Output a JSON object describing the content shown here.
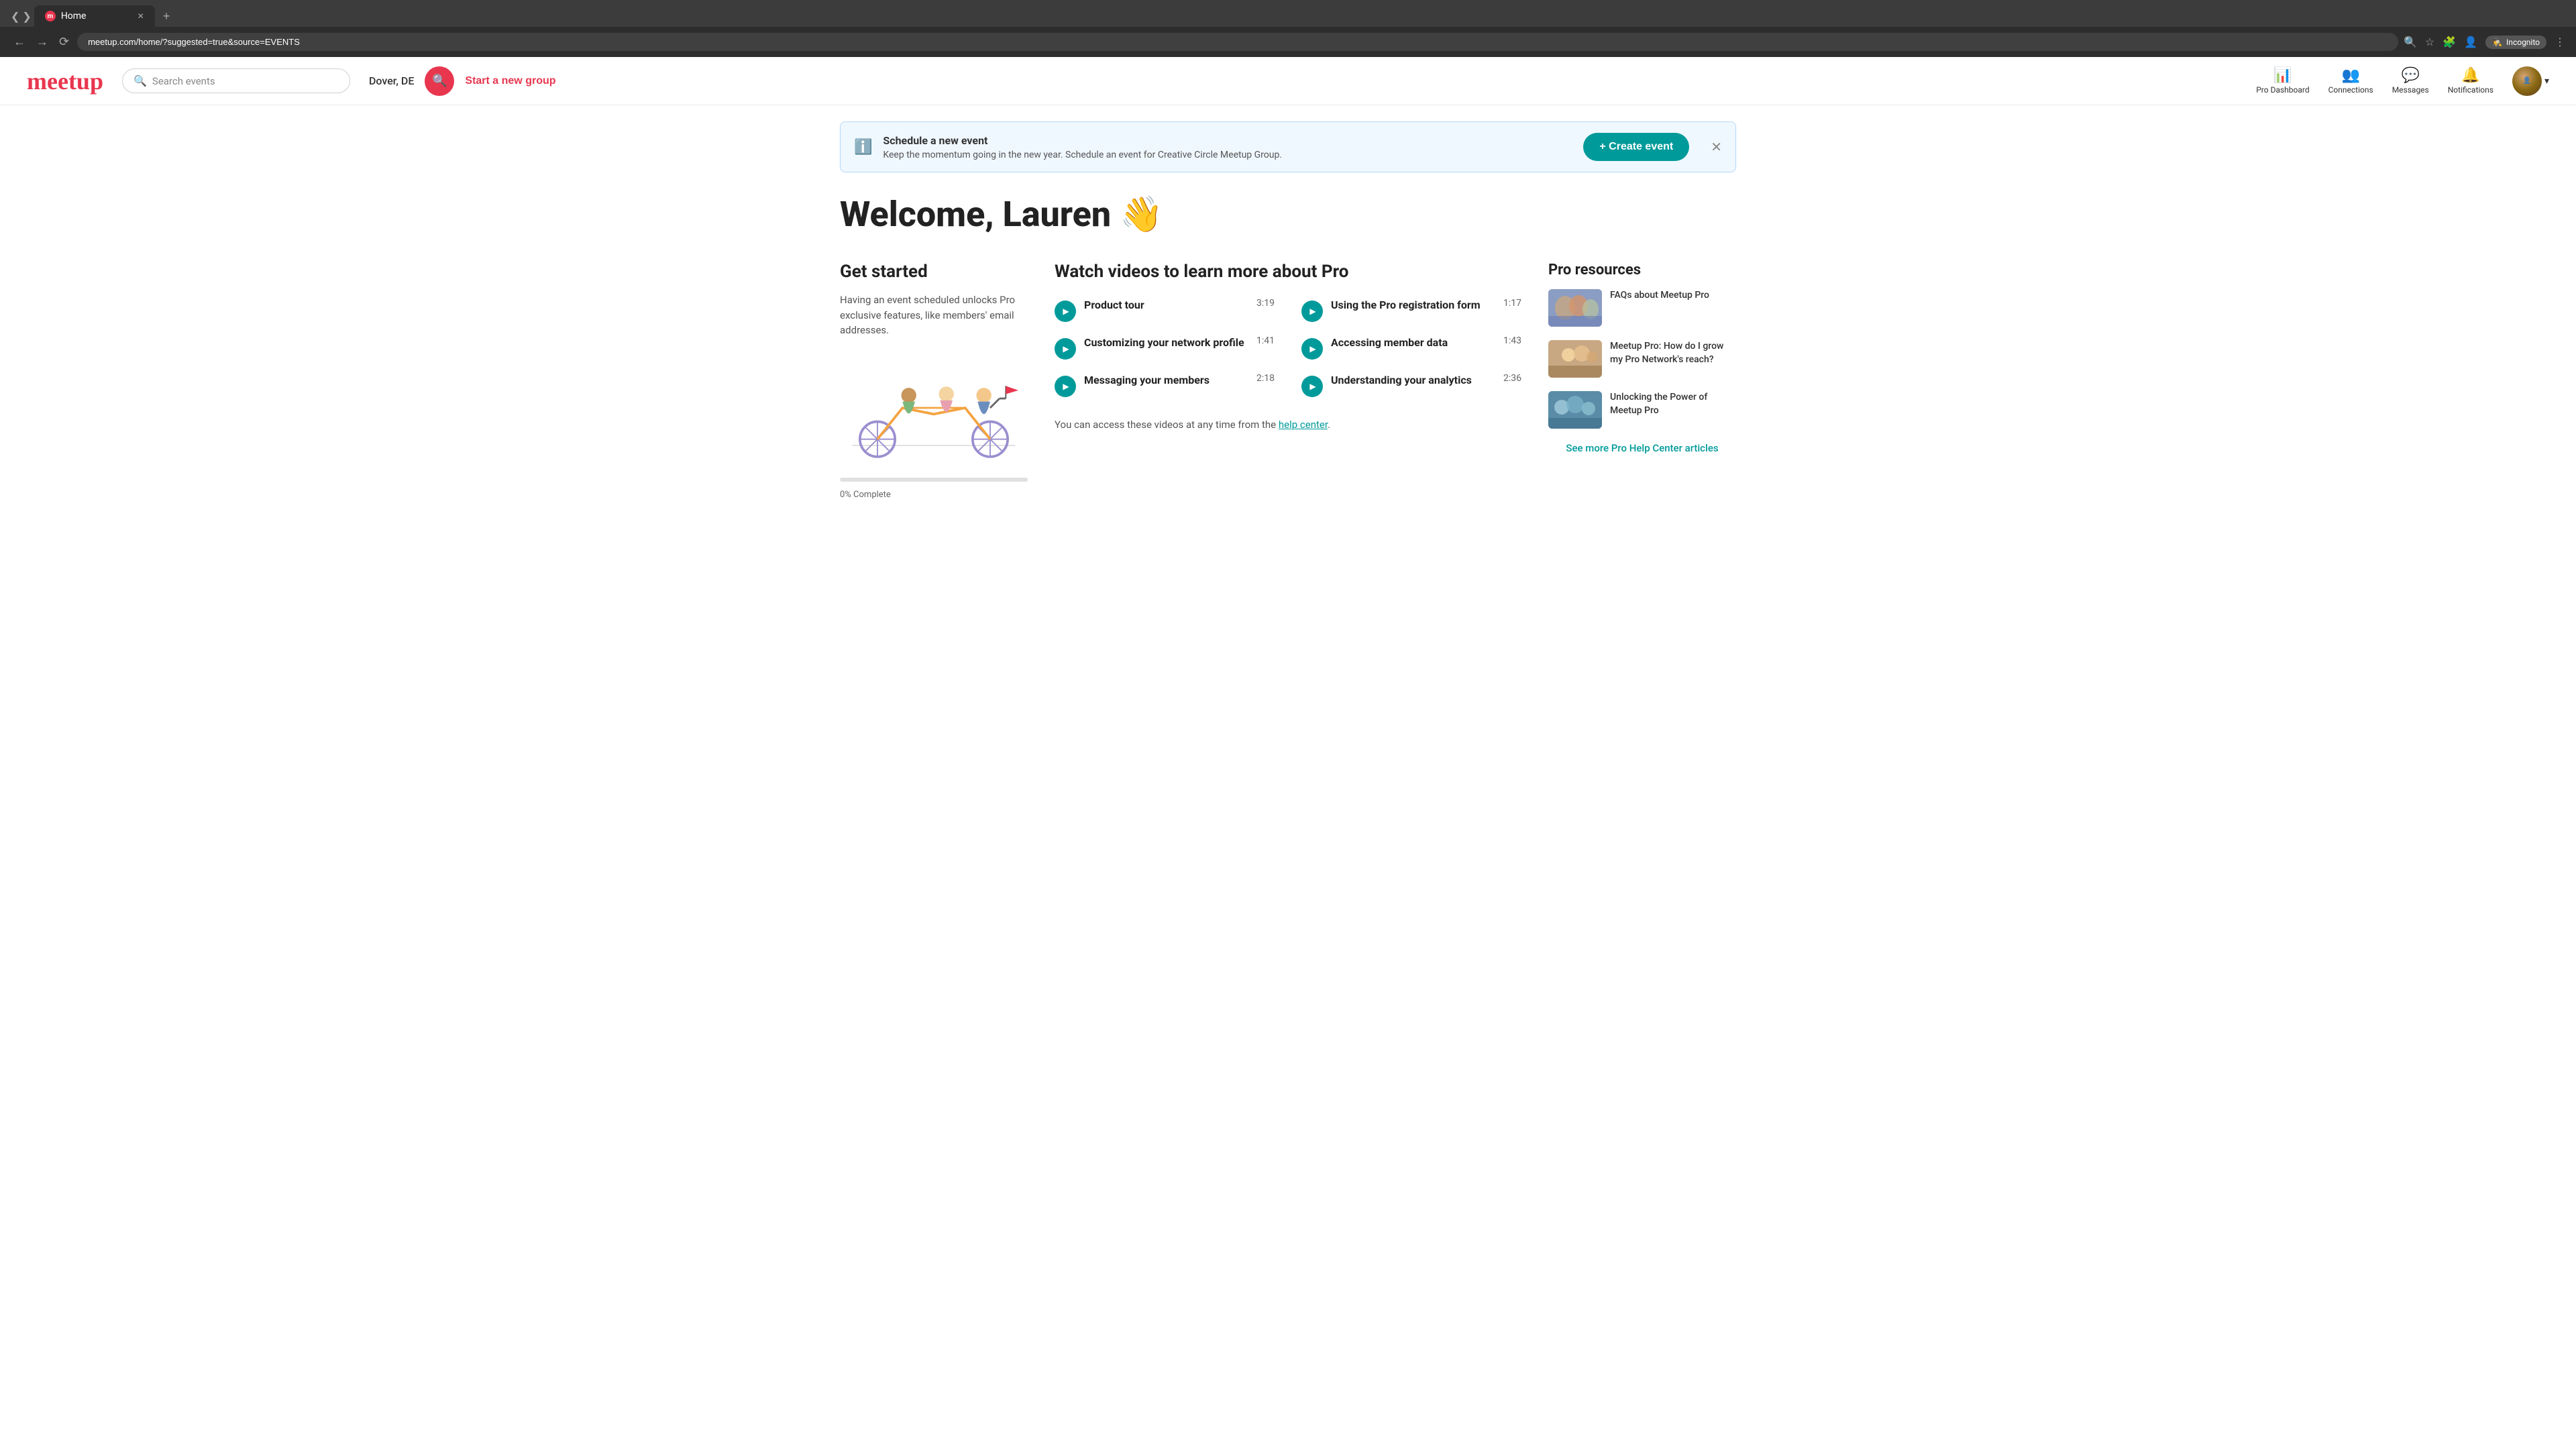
{
  "browser": {
    "tab_label": "Home",
    "tab_favicon": "m",
    "address": "meetup.com/home/?suggested=true&source=EVENTS",
    "incognito_label": "Incognito"
  },
  "nav": {
    "logo": "meetup",
    "search_placeholder": "Search events",
    "location": "Dover, DE",
    "start_group_label": "Start a new group",
    "pro_dashboard_label": "Pro Dashboard",
    "connections_label": "Connections",
    "messages_label": "Messages",
    "notifications_label": "Notifications"
  },
  "banner": {
    "title": "Schedule a new event",
    "description": "Keep the momentum going in the new year. Schedule an event for Creative Circle Meetup Group.",
    "create_label": "+ Create event"
  },
  "welcome": {
    "heading": "Welcome, Lauren 👋"
  },
  "get_started": {
    "title": "Get started",
    "description": "Having an event scheduled unlocks Pro exclusive features, like members' email addresses.",
    "progress_label": "0% Complete"
  },
  "videos": {
    "title": "Watch videos to learn more about Pro",
    "items": [
      {
        "title": "Product tour",
        "duration": "3:19"
      },
      {
        "title": "Using the Pro registration form",
        "duration": "1:17"
      },
      {
        "title": "Customizing your network profile",
        "duration": "1:41"
      },
      {
        "title": "Accessing member data",
        "duration": "1:43"
      },
      {
        "title": "Messaging your members",
        "duration": "2:18"
      },
      {
        "title": "Understanding your analytics",
        "duration": "2:36"
      }
    ],
    "help_text": "You can access these videos at any time from the",
    "help_link_text": "help center",
    "help_suffix": "."
  },
  "pro_resources": {
    "title": "Pro resources",
    "items": [
      {
        "title": "FAQs about Meetup Pro"
      },
      {
        "title": "Meetup Pro: How do I grow my Pro Network's reach?"
      },
      {
        "title": "Unlocking the Power of Meetup Pro"
      }
    ],
    "see_more_label": "See more Pro Help Center articles"
  }
}
